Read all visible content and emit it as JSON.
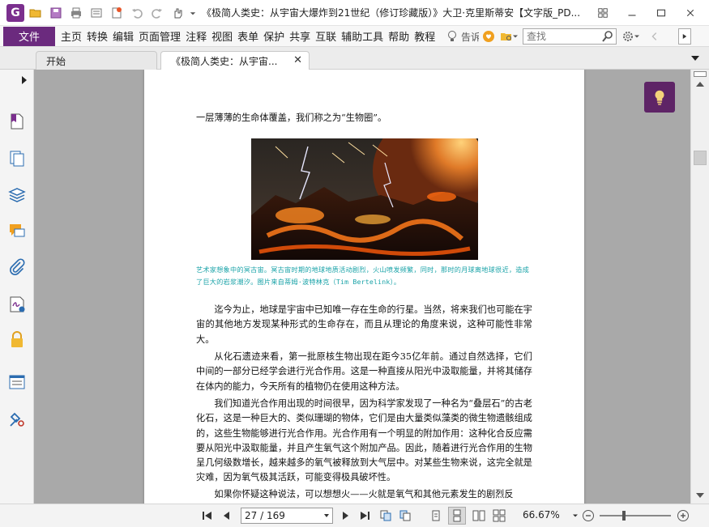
{
  "app": {
    "logo_letter": "G",
    "window_title": "《极简人类史：从宇宙大爆炸到21世纪（修订珍藏版）》大卫·克里斯蒂安【文字版_PD..."
  },
  "menu": {
    "file": "文件",
    "items": [
      "主页",
      "转换",
      "编辑",
      "页面管理",
      "注释",
      "视图",
      "表单",
      "保护",
      "共享",
      "互联",
      "辅助工具",
      "帮助",
      "教程"
    ],
    "tell_me": "告诉",
    "search_placeholder": "查找"
  },
  "tabs": [
    {
      "label": "开始",
      "active": false
    },
    {
      "label": "《极简人类史：从宇宙...",
      "active": true
    }
  ],
  "document": {
    "intro_line": "一层薄薄的生命体覆盖，我们称之为“生物圈”。",
    "caption": "艺术家想象中的冥古宙。冥古宙时期的地球地质活动剧烈，火山喷发频繁，同时，那时的月球离地球很近，造成了巨大的岩浆潮汐。图片来自蒂姆·波特林克（Tim Bertelink）。",
    "paragraphs": [
      "迄今为止，地球是宇宙中已知唯一存在生命的行星。当然，将来我们也可能在宇宙的其他地方发现某种形式的生命存在，而且从理论的角度来说，这种可能性非常大。",
      "从化石遗迹来看，第一批原核生物出现在距今35亿年前。通过自然选择，它们中间的一部分已经学会进行光合作用。这是一种直接从阳光中汲取能量，并将其储存在体内的能力，今天所有的植物仍在使用这种方法。",
      "我们知道光合作用出现的时间很早，因为科学家发现了一种名为“叠层石”的古老化石，这是一种巨大的、类似珊瑚的物体，它们是由大量类似藻类的微生物遗骸组成的，这些生物能够进行光合作用。光合作用有一个明显的附加作用：这种化合反应需要从阳光中汲取能量，并且产生氧气这个附加产品。因此，随着进行光合作用的生物呈几何级数增长，越来越多的氧气被释放到大气层中。对某些生物来说，这完全就是灾难，因为氧气极其活跃，可能变得极具破坏性。",
      "如果你怀疑这种说法，可以想想火——火就是氧气和其他元素发生的剧烈反"
    ]
  },
  "status": {
    "page_display": "27 / 169",
    "current_page": 27,
    "total_pages": 169,
    "zoom": "66.67%"
  },
  "colors": {
    "brand": "#6b2a7e",
    "caption": "#1aa3a8",
    "canvas": "#a9a9a9"
  }
}
